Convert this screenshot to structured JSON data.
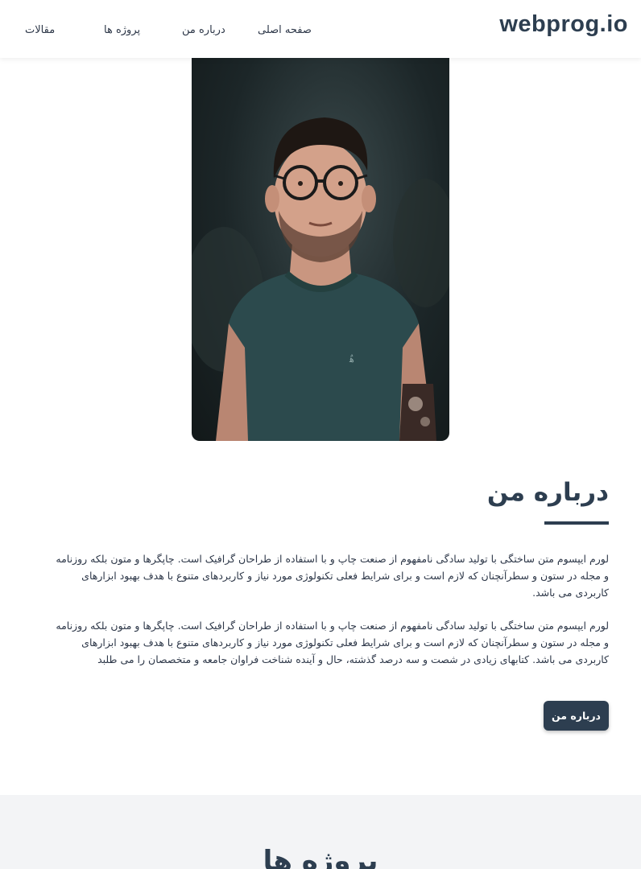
{
  "header": {
    "logo": "webprog.io",
    "nav": {
      "home": "صفحه اصلی",
      "about": "درباره من",
      "projects": "پروژه ها",
      "articles": "مقالات"
    }
  },
  "about": {
    "title": "درباره من",
    "paragraphs": [
      "لورم ایپسوم متن ساختگی با تولید سادگی نامفهوم از صنعت چاپ و با استفاده از طراحان گرافیک است. چاپگرها و متون بلکه روزنامه و مجله در ستون و سطرآنچنان که لازم است و برای شرایط فعلی تکنولوژی مورد نیاز و کاربردهای متنوع با هدف بهبود ابزارهای کاربردی می باشد.",
      "لورم ایپسوم متن ساختگی با تولید سادگی نامفهوم از صنعت چاپ و با استفاده از طراحان گرافیک است. چاپگرها و متون بلکه روزنامه و مجله در ستون و سطرآنچنان که لازم است و برای شرایط فعلی تکنولوژی مورد نیاز و کاربردهای متنوع با هدف بهبود ابزارهای کاربردی می باشد. کتابهای زیادی در شصت و سه درصد گذشته، حال و آینده شناخت فراوان جامعه و متخصصان را می طلبد"
    ],
    "button_label": "درباره من"
  },
  "next_section": {
    "title": "پروژه ها"
  },
  "colors": {
    "primary": "#2d3e50",
    "text": "#2d3748",
    "section_bg": "#f3f4f6"
  }
}
